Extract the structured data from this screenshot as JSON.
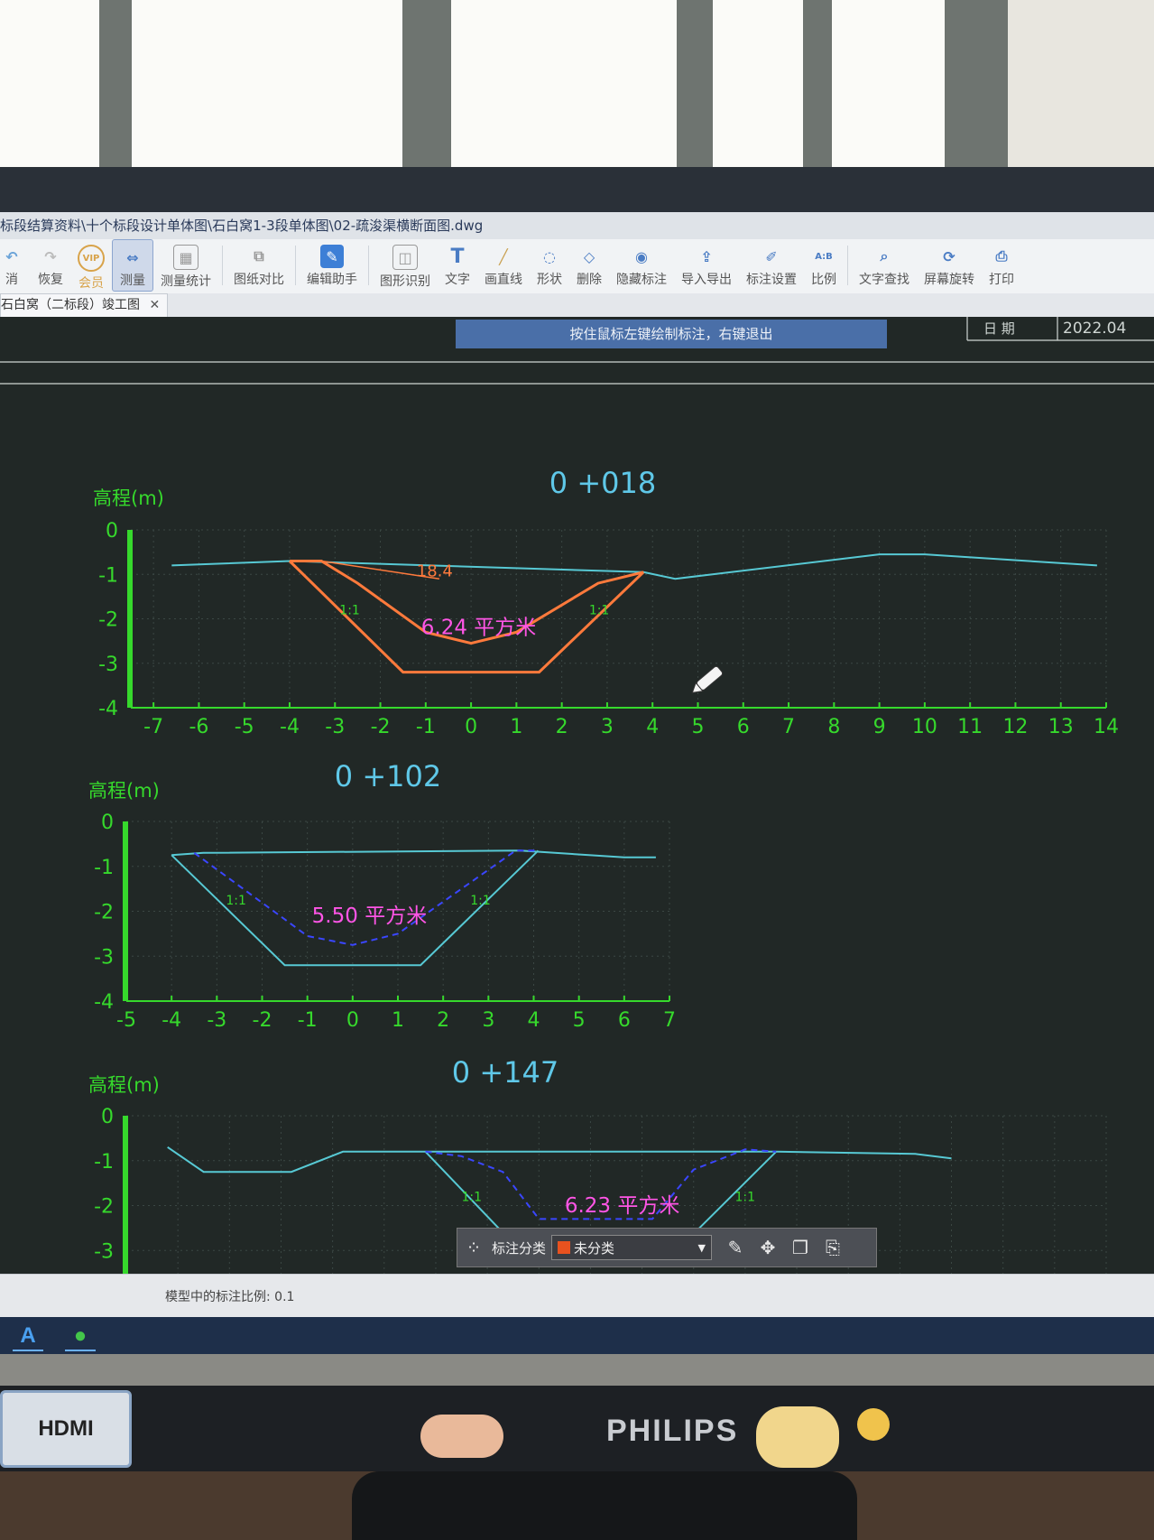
{
  "app": {
    "title_path": "标段结算资料\\十个标段设计单体图\\石白窝1-3段单体图\\02-疏浚渠横断面图.dwg",
    "tab_label": "石白窝（二标段）竣工图",
    "hint": "按住鼠标左键绘制标注，右键退出",
    "status": "模型中的标注比例: 0.1",
    "date_label": "日  期",
    "date_value": "2022.04"
  },
  "toolbar": {
    "items": [
      {
        "label": "消",
        "icon": "undo-icon"
      },
      {
        "label": "恢复",
        "icon": "redo-icon"
      },
      {
        "label": "会员",
        "icon": "vip-icon"
      },
      {
        "label": "测量",
        "icon": "measure-icon"
      },
      {
        "label": "测量统计",
        "icon": "measure-stats-icon"
      },
      {
        "label": "图纸对比",
        "icon": "compare-icon"
      },
      {
        "label": "编辑助手",
        "icon": "edit-assistant-icon"
      },
      {
        "label": "图形识别",
        "icon": "shape-recognize-icon"
      },
      {
        "label": "文字",
        "icon": "text-icon"
      },
      {
        "label": "画直线",
        "icon": "line-icon"
      },
      {
        "label": "形状",
        "icon": "shape-icon"
      },
      {
        "label": "删除",
        "icon": "eraser-icon"
      },
      {
        "label": "隐藏标注",
        "icon": "hide-annotation-icon"
      },
      {
        "label": "导入导出",
        "icon": "import-export-icon"
      },
      {
        "label": "标注设置",
        "icon": "annotation-settings-icon"
      },
      {
        "label": "比例",
        "icon": "scale-icon"
      },
      {
        "label": "文字查找",
        "icon": "text-search-icon"
      },
      {
        "label": "屏幕旋转",
        "icon": "rotate-screen-icon"
      },
      {
        "label": "打印",
        "icon": "print-icon"
      }
    ],
    "vip_badge": "VIP",
    "text_glyph": "T",
    "scale_glyph": "A:B"
  },
  "annotation_toolbar": {
    "label": "标注分类",
    "selected": "未分类",
    "swatch_color": "#e8521f"
  },
  "colors": {
    "canvas": "#212826",
    "axis": "#36d92c",
    "ground": "#57c9d4",
    "design": "#ff7a3c",
    "dashed": "#3a46ff",
    "area_text": "#ff55e6",
    "title": "#5fc8e8"
  },
  "chart_data": [
    {
      "type": "line",
      "title": "0 +018",
      "ylabel": "高程(m)",
      "xlim": [
        -7.5,
        14
      ],
      "ylim": [
        -4,
        0
      ],
      "x_ticks": [
        -7,
        -6,
        -5,
        -4,
        -3,
        -2,
        -1,
        0,
        1,
        2,
        3,
        4,
        5,
        6,
        7,
        8,
        9,
        10,
        11,
        12,
        13,
        14
      ],
      "y_ticks": [
        0,
        -1,
        -2,
        -3,
        -4
      ],
      "series": [
        {
          "role": "ground",
          "points": [
            [
              -6.6,
              -0.8
            ],
            [
              -4.0,
              -0.7
            ],
            [
              3.8,
              -0.95
            ],
            [
              4.5,
              -1.1
            ],
            [
              9.0,
              -0.55
            ],
            [
              10.0,
              -0.55
            ],
            [
              13.8,
              -0.8
            ]
          ]
        },
        {
          "role": "design",
          "points": [
            [
              -4.0,
              -0.7
            ],
            [
              -1.5,
              -3.2
            ],
            [
              1.5,
              -3.2
            ],
            [
              3.8,
              -0.95
            ]
          ]
        },
        {
          "role": "measured",
          "points": [
            [
              -4.0,
              -0.7
            ],
            [
              -3.3,
              -0.7
            ],
            [
              -2.5,
              -1.2
            ],
            [
              -1.0,
              -2.3
            ],
            [
              0,
              -2.55
            ],
            [
              1.0,
              -2.3
            ],
            [
              2.8,
              -1.2
            ],
            [
              3.8,
              -0.95
            ]
          ]
        },
        {
          "role": "leader",
          "points": [
            [
              -3.3,
              -0.7
            ],
            [
              -0.7,
              -1.1
            ]
          ]
        }
      ],
      "annotations": [
        {
          "text": "18.4",
          "x": -1.2,
          "y": -1.05
        },
        {
          "text": "6.24 平方米",
          "x": -1.1,
          "y": -2.35
        },
        {
          "text": "1:1",
          "x": -2.9,
          "y": -1.9
        },
        {
          "text": "1:1",
          "x": 2.6,
          "y": -1.9
        }
      ]
    },
    {
      "type": "line",
      "title": "0 +102",
      "ylabel": "高程(m)",
      "xlim": [
        -5,
        7
      ],
      "ylim": [
        -4,
        0
      ],
      "x_ticks": [
        -5,
        -4,
        -3,
        -2,
        -1,
        0,
        1,
        2,
        3,
        4,
        5,
        6,
        7
      ],
      "y_ticks": [
        0,
        -1,
        -2,
        -3,
        -4
      ],
      "series": [
        {
          "role": "ground",
          "points": [
            [
              -4.0,
              -0.75
            ],
            [
              -3.3,
              -0.7
            ],
            [
              3.7,
              -0.65
            ],
            [
              6.0,
              -0.8
            ],
            [
              6.7,
              -0.8
            ]
          ]
        },
        {
          "role": "design",
          "points": [
            [
              -4.0,
              -0.75
            ],
            [
              -1.5,
              -3.2
            ],
            [
              1.5,
              -3.2
            ],
            [
              4.1,
              -0.65
            ]
          ]
        },
        {
          "role": "dashed",
          "points": [
            [
              -3.5,
              -0.7
            ],
            [
              -1.0,
              -2.55
            ],
            [
              0,
              -2.75
            ],
            [
              1.0,
              -2.5
            ],
            [
              3.6,
              -0.65
            ],
            [
              4.1,
              -0.65
            ]
          ]
        }
      ],
      "annotations": [
        {
          "text": "5.50 平方米",
          "x": -0.9,
          "y": -2.25
        },
        {
          "text": "1:1",
          "x": -2.8,
          "y": -1.85
        },
        {
          "text": "1:1",
          "x": 2.6,
          "y": -1.85
        }
      ]
    },
    {
      "type": "line",
      "title": "0 +147",
      "ylabel": "高程(m)",
      "xlim": [
        -5,
        14
      ],
      "ylim": [
        -4,
        0
      ],
      "x_ticks": [],
      "y_ticks": [
        0,
        -1,
        -2,
        -3
      ],
      "series": [
        {
          "role": "ground",
          "points": [
            [
              -4.2,
              -0.7
            ],
            [
              -3.5,
              -1.25
            ],
            [
              -1.8,
              -1.25
            ],
            [
              -0.8,
              -0.8
            ],
            [
              0.8,
              -0.8
            ],
            [
              7.6,
              -0.8
            ],
            [
              10.3,
              -0.85
            ],
            [
              11.0,
              -0.95
            ]
          ]
        },
        {
          "role": "design",
          "points": [
            [
              0.8,
              -0.8
            ],
            [
              2.8,
              -3.2
            ],
            [
              5.5,
              -3.2
            ],
            [
              7.6,
              -0.8
            ]
          ]
        },
        {
          "role": "dashed",
          "points": [
            [
              0.8,
              -0.8
            ],
            [
              1.5,
              -0.9
            ],
            [
              2.3,
              -1.25
            ],
            [
              3.0,
              -2.3
            ],
            [
              5.2,
              -2.3
            ],
            [
              6.0,
              -1.2
            ],
            [
              7.0,
              -0.75
            ],
            [
              7.6,
              -0.8
            ]
          ]
        }
      ],
      "annotations": [
        {
          "text": "6.23 平方米",
          "x": 3.5,
          "y": -2.15
        },
        {
          "text": "1:1",
          "x": 1.5,
          "y": -1.9
        },
        {
          "text": "1:1",
          "x": 6.8,
          "y": -1.9
        }
      ]
    }
  ]
}
